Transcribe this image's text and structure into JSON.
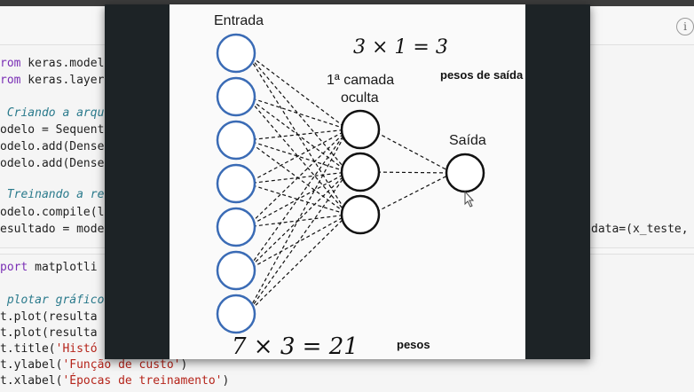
{
  "notebook": {
    "cell1_lines": [
      {
        "kw": "rom",
        "rest": " keras.model"
      },
      {
        "kw": "rom",
        "rest": " keras.layer"
      },
      {
        "comment": " Criando a arqu"
      },
      {
        "plain": "odelo = Sequent"
      },
      {
        "plain": "odelo.add(Dense"
      },
      {
        "plain": "odelo.add(Dense"
      },
      {
        "comment": " Treinando a re"
      },
      {
        "plain": "odelo.compile(l"
      },
      {
        "plain": "esultado = mode"
      }
    ],
    "cell1_right": "data=(x_teste,",
    "cell2_lines": [
      {
        "kw": "port",
        "rest": " matplotli"
      },
      {
        "comment": " plotar gráfico"
      },
      {
        "plain": "t.plot(resulta"
      },
      {
        "plain": "t.plot(resulta"
      },
      {
        "plain": "t.title(",
        "str": "'Histó"
      },
      {
        "plain": "t.ylabel(",
        "str": "'Função de custo'",
        "tail": ")"
      },
      {
        "plain": "t.xlabel(",
        "str": "'Épocas de treinamento'",
        "tail": ")"
      }
    ],
    "info_icon": "i"
  },
  "diagram": {
    "input_label": "Entrada",
    "hidden_label_line1": "1ª camada",
    "hidden_label_line2": "oculta",
    "output_label": "Saída",
    "input_count": 7,
    "hidden_count": 3,
    "output_count": 1,
    "node_color_input": "#3a6bb5",
    "node_color_other": "#111111"
  },
  "annotations": {
    "top_hand": "3  ×  1 = 3",
    "top_note": "pesos de saída",
    "bottom_hand": "7  ×  3 = 21",
    "bottom_note": "pesos"
  }
}
